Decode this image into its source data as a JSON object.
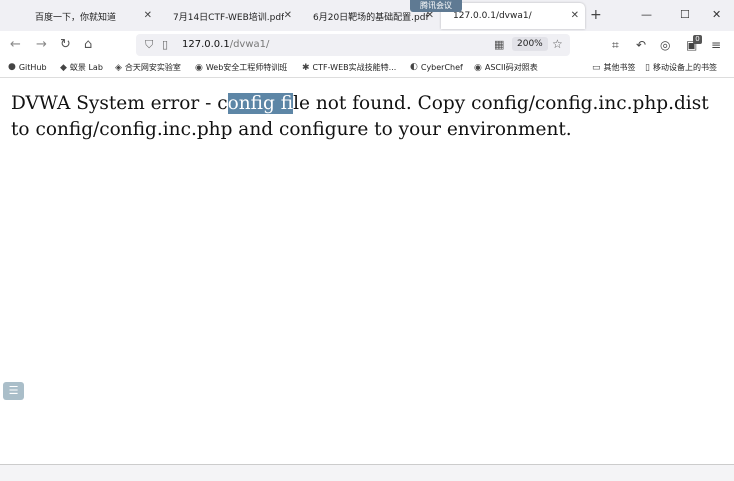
{
  "tabs": [
    {
      "title": "百度一下，你就知道",
      "active": false
    },
    {
      "title": "7月14日CTF-WEB培训.pdf",
      "active": false
    },
    {
      "title": "6月20日靶场的基础配置.pdf",
      "active": false
    },
    {
      "title": "127.0.0.1/dvwa1/",
      "active": true
    }
  ],
  "meeting_badge": "腾讯会议",
  "newtab_symbol": "+",
  "window_controls": {
    "minimize": "—",
    "maximize": "☐",
    "close": "✕"
  },
  "nav": {
    "back": "←",
    "forward": "→",
    "reload": "↻",
    "home": "⌂"
  },
  "url": {
    "host": "127.0.0.1",
    "path": "/dvwa1/",
    "zoom": "200%"
  },
  "toolbar_notification_count": "0",
  "bookmarks": [
    {
      "icon": "github-icon",
      "glyph": "●",
      "label": "GitHub"
    },
    {
      "icon": "shield-icon",
      "glyph": "◆",
      "label": "蚁景 Lab"
    },
    {
      "icon": "lock-icon",
      "glyph": "◈",
      "label": "合天网安实验室"
    },
    {
      "icon": "globe-icon",
      "glyph": "◉",
      "label": "Web安全工程师特训班"
    },
    {
      "icon": "flag-icon",
      "glyph": "✱",
      "label": "CTF-WEB实战技能特..."
    },
    {
      "icon": "chef-icon",
      "glyph": "◐",
      "label": "CyberChef"
    },
    {
      "icon": "globe-icon",
      "glyph": "◉",
      "label": "ASCII码对照表"
    },
    {
      "icon": "folder-icon",
      "glyph": "▭",
      "label": "其他书签"
    },
    {
      "icon": "mobile-icon",
      "glyph": "▯",
      "label": "移动设备上的书签"
    }
  ],
  "message": {
    "before": "DVWA System error - c",
    "selected": "onfig f",
    "after": "ile not found. Copy config/config.inc.php.dist to config/config.inc.php and configure to your environment."
  },
  "side_button_symbol": "☰"
}
